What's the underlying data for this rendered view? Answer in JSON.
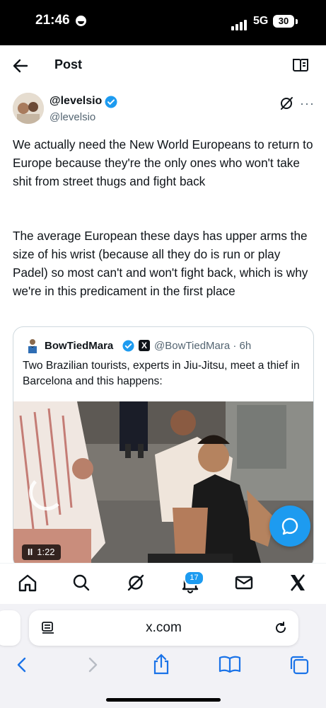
{
  "status_bar": {
    "time": "21:46",
    "network": "5G",
    "battery": "30"
  },
  "header": {
    "title": "Post"
  },
  "tweet": {
    "display_name": "@levelsio",
    "handle": "@levelsio",
    "more_label": "···",
    "paragraphs": [
      "We actually need the New World Europeans to return to Europe because they're the only ones who won't take shit from street thugs and fight back",
      "The average European these days has upper arms the size of his wrist (because all they do is run or play Padel) so most can't and won't fight back, which is why we're in this predicament in the first place"
    ]
  },
  "quote": {
    "display_name": "BowTiedMara",
    "x_badge": "X",
    "handle_time": "@BowTiedMara · 6h",
    "text": "Two Brazilian tourists, experts in Jiu-Jitsu, meet a thief in Barcelona and this happens:",
    "video_pause": "II",
    "video_time": "1:22"
  },
  "tab_bar": {
    "items": [
      "home-icon",
      "search-icon",
      "grok-icon",
      "notifications-icon",
      "messages-icon",
      "x-logo-icon"
    ],
    "notification_count": "17"
  },
  "browser": {
    "url": "x.com"
  },
  "colors": {
    "accent": "#1d9bf0",
    "text": "#0f1419",
    "secondary": "#536471"
  }
}
